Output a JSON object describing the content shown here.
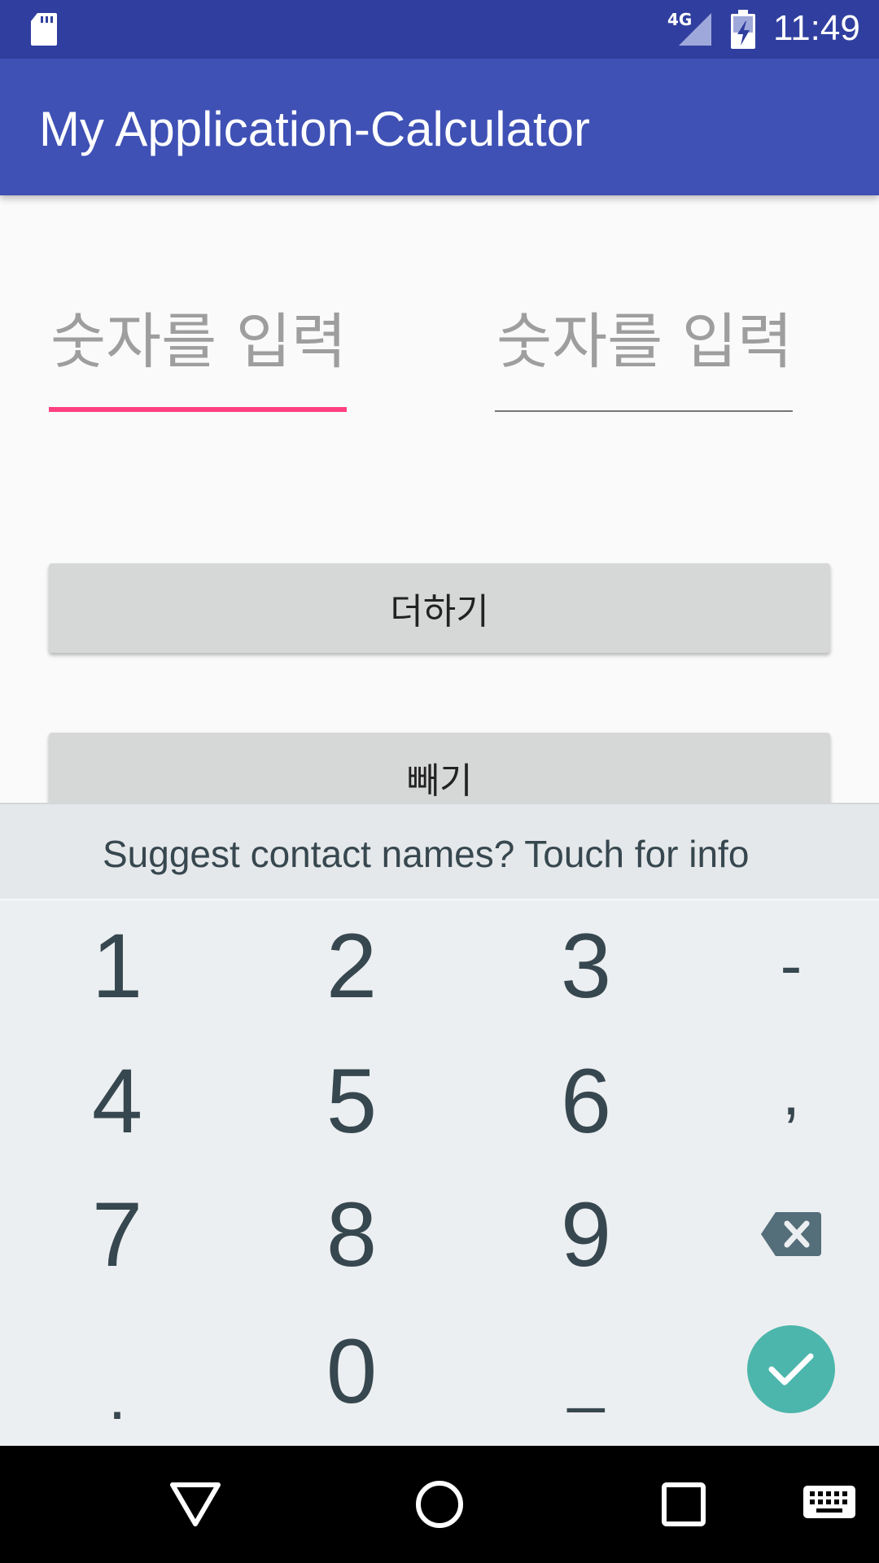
{
  "status_bar": {
    "network": "4G",
    "time": "11:49",
    "icons": [
      "sd-card-icon",
      "signal-icon",
      "battery-charging-icon"
    ]
  },
  "app_bar": {
    "title": "My Application-Calculator"
  },
  "inputs": [
    {
      "placeholder": "숫자를 입력",
      "value": "",
      "focused": true
    },
    {
      "placeholder": "숫자를 입력",
      "value": "",
      "focused": false
    }
  ],
  "buttons": {
    "add": "더하기",
    "subtract": "빼기"
  },
  "keyboard": {
    "suggestion": "Suggest contact names? Touch for info",
    "keys": {
      "k1": "1",
      "k2": "2",
      "k3": "3",
      "minus": "-",
      "k4": "4",
      "k5": "5",
      "k6": "6",
      "comma": ",",
      "k7": "7",
      "k8": "8",
      "k9": "9",
      "period": ".",
      "k0": "0",
      "space": "_"
    },
    "icons": [
      "backspace-icon",
      "check-icon"
    ],
    "enter_color": "#4db6ac"
  },
  "nav_bar": {
    "icons": [
      "back-icon",
      "home-icon",
      "recents-icon",
      "keyboard-switch-icon"
    ]
  },
  "colors": {
    "status_bar": "#303f9f",
    "primary": "#3f51b5",
    "accent": "#ff4081",
    "button": "#d6d7d7"
  }
}
